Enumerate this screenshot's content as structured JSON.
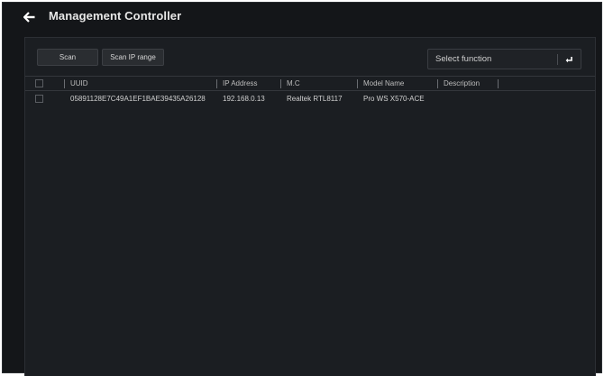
{
  "header": {
    "title": "Management Controller",
    "back_icon": "arrow-left-icon"
  },
  "toolbar": {
    "scan_label": "Scan",
    "scan_range_label": "Scan IP range"
  },
  "function_select": {
    "selected": "Select function",
    "icon": "enter-icon"
  },
  "table": {
    "columns": [
      "UUID",
      "IP Address",
      "M.C",
      "Model Name",
      "Description"
    ],
    "rows": [
      {
        "uuid": "05891128E7C49A1EF1BAE39435A26128",
        "ip": "192.168.0.13",
        "mc": "Realtek RTL8117",
        "model": "Pro WS X570-ACE",
        "description": ""
      }
    ]
  },
  "colors": {
    "background": "#141619",
    "panel": "#1b1e22",
    "text": "#d0d0d0"
  }
}
